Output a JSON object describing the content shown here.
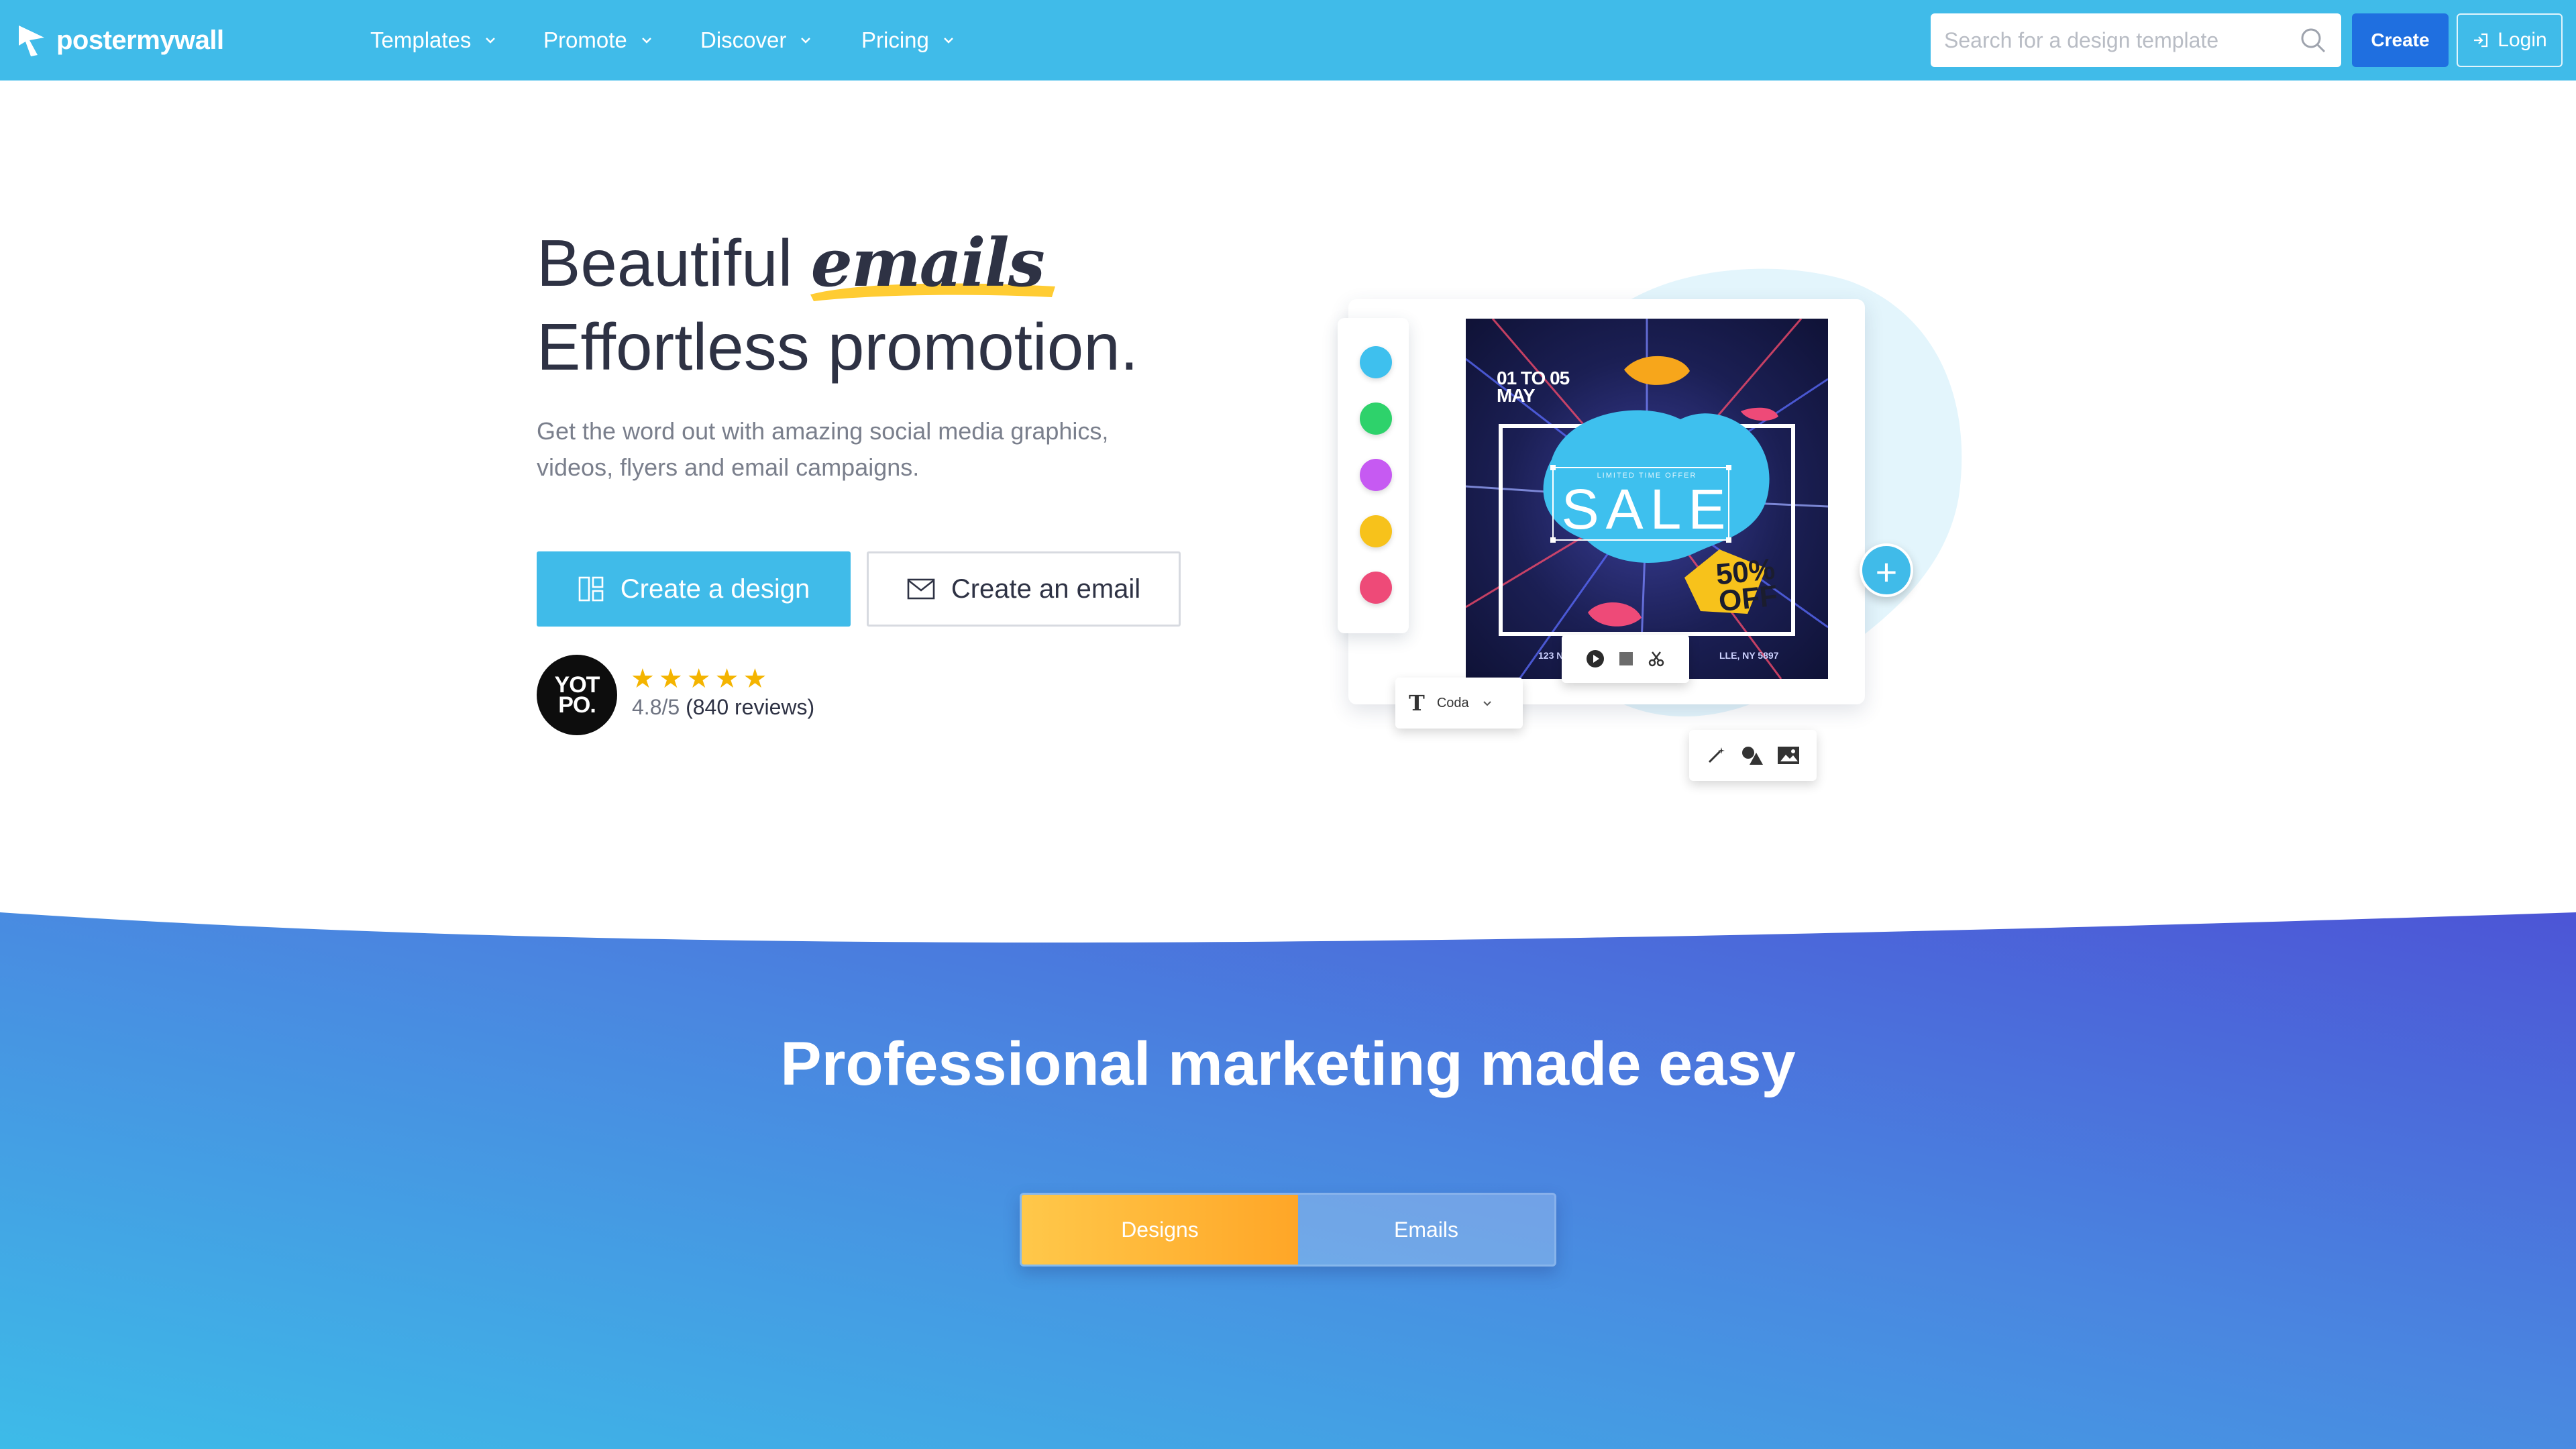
{
  "brand": {
    "name": "postermywall",
    "accent": "#40bbe9",
    "primary_button": "#1f6fe0"
  },
  "nav": {
    "items": [
      {
        "label": "Templates",
        "icon": "chevron-down-icon"
      },
      {
        "label": "Promote",
        "icon": "chevron-down-icon"
      },
      {
        "label": "Discover",
        "icon": "chevron-down-icon"
      },
      {
        "label": "Pricing",
        "icon": "chevron-down-icon"
      }
    ],
    "search_placeholder": "Search for a design template",
    "create_label": "Create",
    "login_label": "Login"
  },
  "hero": {
    "title_word1": "Beautiful",
    "title_emphasis": "emails",
    "title_line2": "Effortless promotion.",
    "subtitle": "Get the word out with amazing social media graphics, videos, flyers and email campaigns.",
    "primary_cta": "Create a design",
    "secondary_cta": "Create an email",
    "review_badge_line1": "YOT",
    "review_badge_line2": "PO.",
    "stars": 5,
    "rating": "4.8/5",
    "reviews": "(840 reviews)"
  },
  "illustration": {
    "swatch_colors": [
      "#3ec0ee",
      "#2ed26b",
      "#c65af2",
      "#f7c21b",
      "#ee4a78"
    ],
    "poster_date_line1": "01 TO 05",
    "poster_date_line2": "MAY",
    "poster_small": "LIMITED TIME OFFER",
    "poster_headline": "SALE",
    "poster_discount_line1": "50%",
    "poster_discount_line2": "OFF",
    "poster_address_left": "123 N",
    "poster_address_right": "LLE, NY 5897",
    "font_name": "Coda"
  },
  "section": {
    "title": "Professional marketing made easy",
    "tabs": [
      {
        "label": "Designs",
        "active": true
      },
      {
        "label": "Emails",
        "active": false
      }
    ]
  }
}
